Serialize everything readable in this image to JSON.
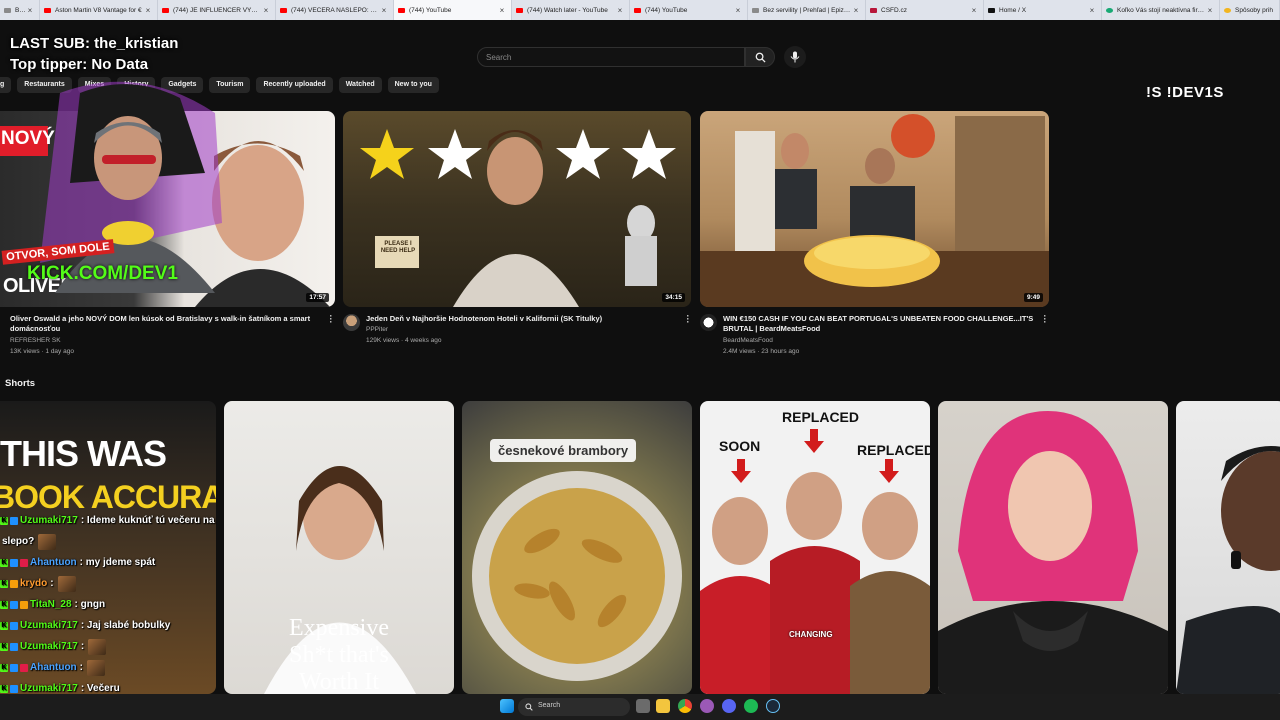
{
  "browser": {
    "tabs": [
      {
        "title": "Buy",
        "icon": "generic-tab-icon"
      },
      {
        "title": "Aston Martin V8 Vantage for €",
        "icon": "gmail-icon"
      },
      {
        "title": "(744) JE INFLUENCER VÝSMEC",
        "icon": "youtube-icon"
      },
      {
        "title": "(744) VEČERA NASLEPO: HENR",
        "icon": "youtube-icon"
      },
      {
        "title": "(744) YouTube",
        "icon": "youtube-icon",
        "active": true
      },
      {
        "title": "(744) Watch later - YouTube",
        "icon": "youtube-icon"
      },
      {
        "title": "(744) YouTube",
        "icon": "youtube-icon"
      },
      {
        "title": "Bez servility | Prehľad | Epizódy",
        "icon": "podcast-icon"
      },
      {
        "title": "ČSFD.cz",
        "icon": "csfd-icon"
      },
      {
        "title": "Home / X",
        "icon": "x-icon"
      },
      {
        "title": "Koľko Vás stojí neaktívna firma",
        "icon": "green-icon"
      },
      {
        "title": "Spôsoby prih",
        "icon": "yellow-icon"
      }
    ]
  },
  "youtube": {
    "search_placeholder": "Search",
    "chips": [
      "g",
      "Restaurants",
      "Mixes",
      "History",
      "Gadgets",
      "Tourism",
      "Recently uploaded",
      "Watched",
      "New to you"
    ],
    "videos": [
      {
        "title": "Oliver Oswald a jeho NOVÝ DOM len kúsok od Bratislavy s walk-in šatníkom a smart domácnosťou",
        "channel": "REFRESHER SK",
        "meta": "13K views · 1 day ago",
        "duration": "17:57",
        "thumb_text": [
          "NOVÝ",
          "OLIVER OSWALD"
        ]
      },
      {
        "title": "Jeden Deň v Najhoršie Hodnotenom Hoteli v Kalifornii (SK Titulky)",
        "channel": "PPPiter",
        "meta": "129K views · 4 weeks ago",
        "duration": "34:15",
        "thumb_text": [
          "PLEASE I NEED HELP"
        ]
      },
      {
        "title": "WIN €150 CASH IF YOU CAN BEAT PORTUGAL'S UNBEATEN FOOD CHALLENGE...IT'S BRUTAL | BeardMeatsFood",
        "channel": "BeardMeatsFood",
        "meta": "2.4M views · 23 hours ago",
        "duration": "9:49",
        "thumb_text": []
      }
    ],
    "shorts_label": "Shorts",
    "shorts": [
      {
        "text_top": "THIS WAS",
        "text_mid": "BOOK ACCURATE"
      },
      {
        "text": "Expensive Sh*t that's Worth It"
      },
      {
        "text": "česnekové brambory"
      },
      {
        "labels": [
          "REPLACED",
          "SOON",
          "REPLACED",
          "CHANGING"
        ]
      },
      {
        "text": ""
      },
      {
        "text": ""
      }
    ]
  },
  "stream": {
    "last_sub": "LAST SUB: the_kristian",
    "top_tipper": "Top tipper: No Data",
    "command": "!S !DEV1S",
    "webcam_labels": [
      "OTVOR, SOM DOLE",
      "KICK.COM/DEV1"
    ],
    "chat": [
      {
        "nick": "Uzumaki717",
        "message": ": Ideme kuknúť tú večeru na",
        "continuation": "slepo?"
      },
      {
        "nick": "Ahantuon",
        "message": ": my jdeme spát"
      },
      {
        "nick": "krydo",
        "message": ":"
      },
      {
        "nick": "TitaN_28",
        "message": ": gngn"
      },
      {
        "nick": "Uzumaki717",
        "message": ": Jaj slabé bobulky"
      },
      {
        "nick": "Uzumaki717",
        "message": ":"
      },
      {
        "nick": "Ahantuon",
        "message": ":"
      },
      {
        "nick": "Uzumaki717",
        "message": ": Večeru"
      },
      {
        "nick": "Uzumaki717",
        "message": ":"
      }
    ]
  },
  "taskbar": {
    "search_label": "Search"
  },
  "colors": {
    "background": "#0f0f0f",
    "kick_green": "#53fc18",
    "youtube_red": "#ff0000"
  }
}
